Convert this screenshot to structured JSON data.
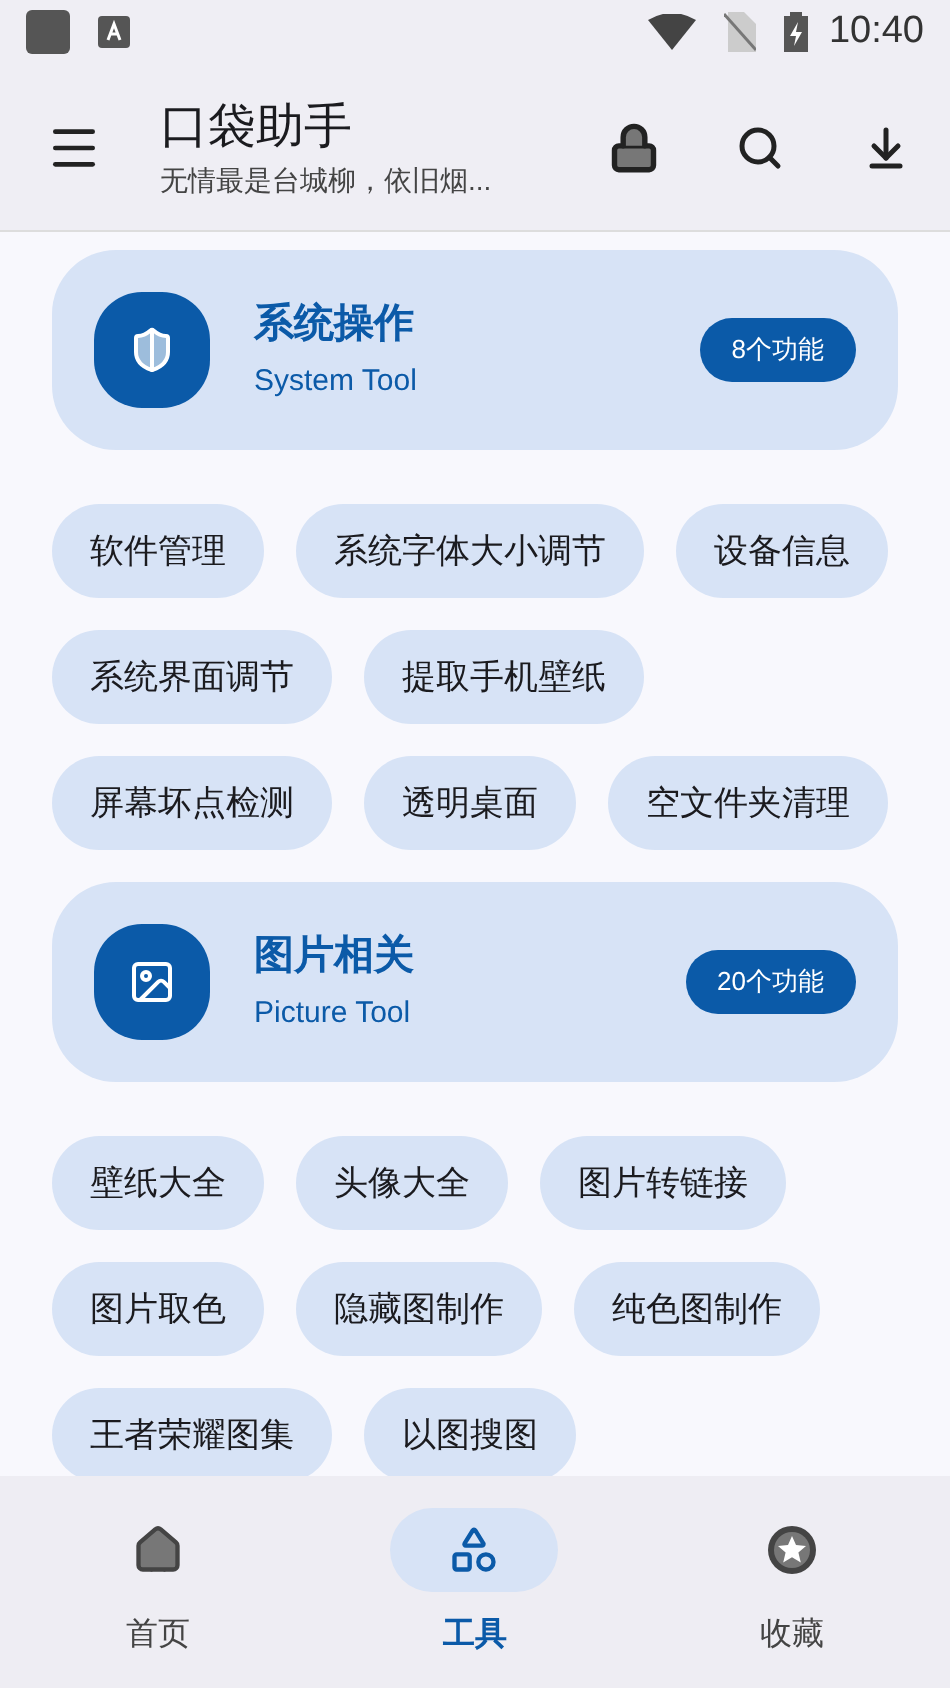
{
  "status_bar": {
    "time": "10:40"
  },
  "app_bar": {
    "title": "口袋助手",
    "subtitle": "无情最是台城柳，依旧烟..."
  },
  "sections": [
    {
      "kind": "system",
      "title": "系统操作",
      "subtitle": "System Tool",
      "count": "8个功能",
      "tools": [
        "软件管理",
        "系统字体大小调节",
        "设备信息",
        "系统界面调节",
        "提取手机壁纸",
        "屏幕坏点检测",
        "透明桌面",
        "空文件夹清理"
      ]
    },
    {
      "kind": "picture",
      "title": "图片相关",
      "subtitle": "Picture Tool",
      "count": "20个功能",
      "tools": [
        "壁纸大全",
        "头像大全",
        "图片转链接",
        "图片取色",
        "隐藏图制作",
        "纯色图制作",
        "王者荣耀图集",
        "以图搜图"
      ]
    }
  ],
  "nav": [
    {
      "kind": "home",
      "label": "首页",
      "selected": false
    },
    {
      "kind": "tools",
      "label": "工具",
      "selected": true
    },
    {
      "kind": "favorites",
      "label": "收藏",
      "selected": false
    }
  ]
}
